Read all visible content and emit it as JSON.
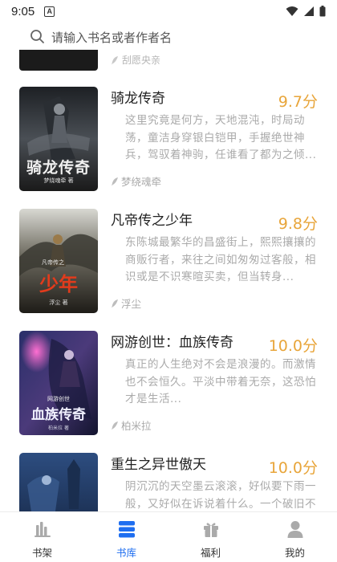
{
  "status_bar": {
    "time": "9:05",
    "notification_letter": "A"
  },
  "search": {
    "placeholder": "请输入书名或者作者名"
  },
  "partial_top": {
    "author": "刮愿央亲"
  },
  "books": [
    {
      "title": "骑龙传奇",
      "score": "9.7分",
      "description": "这里究竟是何方，天地混沌，时局动荡，童洁身穿银白铠甲，手握绝世神兵，驾驭着神驹，任谁看了都为之倾...",
      "author": "梦绕魂牵",
      "cover_title": "骑龙传奇",
      "cover_sub": "梦绕魂牵 著"
    },
    {
      "title": "凡帝传之少年",
      "score": "9.8分",
      "description": "东陈城最繁华的昌盛街上，熙熙攘攘的商贩行者，来往之间如匆匆过客般，相识或是不识寒暄买卖，但当转身...",
      "author": "浮尘",
      "cover_title": "少年",
      "cover_sub": "凡帝传之",
      "cover_author": "浮尘 著"
    },
    {
      "title": "网游创世：血族传奇",
      "score": "10.0分",
      "description": "真正的人生绝对不会是浪漫的。而激情也不会恒久。平淡中带着无奈，这恐怕才是生活...",
      "author": "柏米拉",
      "cover_title": "血族传奇",
      "cover_sub": "网游创世",
      "cover_author": "柏米拉 著"
    },
    {
      "title": "重生之异世傲天",
      "score": "10.0分",
      "description": "阴沉沉的天空墨云滚滚，好似要下雨一般，又好似在诉说着什么。一个破旧不",
      "author": "",
      "cover_title": "",
      "cover_sub": ""
    }
  ],
  "nav": [
    {
      "label": "书架",
      "icon": "bookshelf-icon",
      "active": false
    },
    {
      "label": "书库",
      "icon": "library-icon",
      "active": true
    },
    {
      "label": "福利",
      "icon": "gift-icon",
      "active": false
    },
    {
      "label": "我的",
      "icon": "user-icon",
      "active": false
    }
  ],
  "colors": {
    "accent": "#1e6ef0",
    "score": "#e8a53a",
    "muted": "#aaaaaa"
  }
}
